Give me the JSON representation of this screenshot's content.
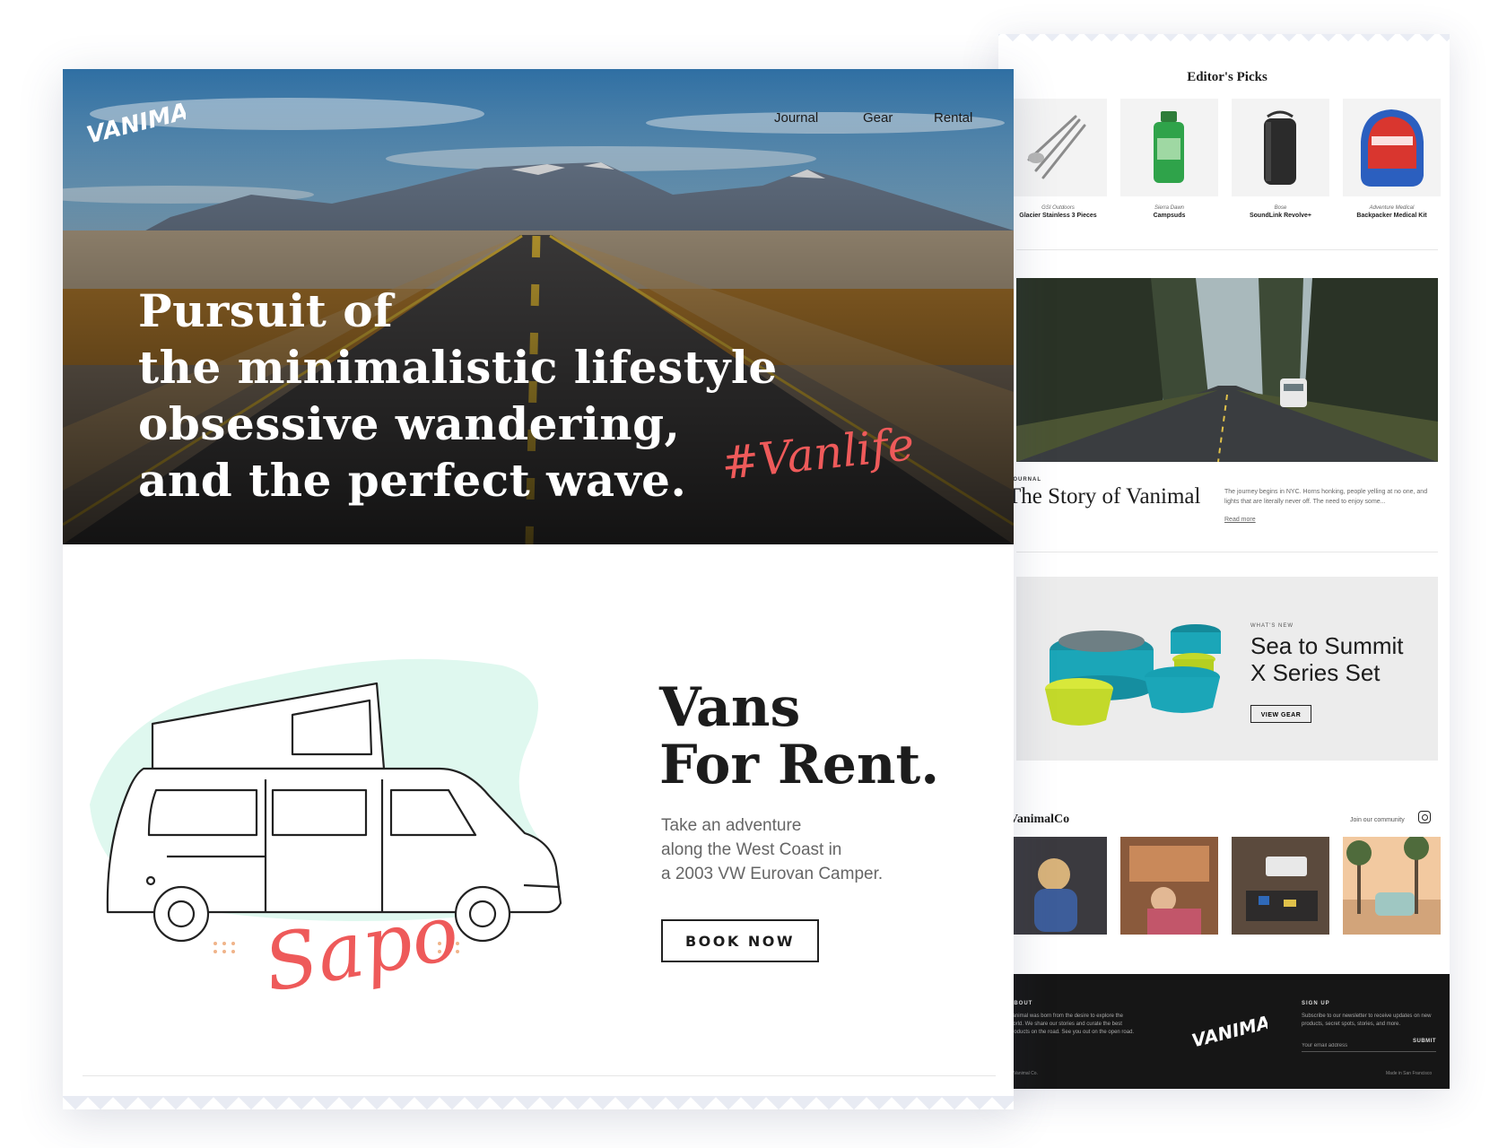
{
  "colors": {
    "accent": "#ee5a5a",
    "mint": "#dff8ef",
    "dark": "#1c1c1c",
    "footer_bg": "#161616"
  },
  "hero": {
    "logo_text": "VANIMAL",
    "nav": [
      "Journal",
      "Gear",
      "Rental"
    ],
    "headline": [
      "Pursuit of",
      "the minimalistic lifestyle",
      "obsessive wandering,",
      "and the perfect wave."
    ],
    "hashtag": "#Vanlife"
  },
  "rental": {
    "title": [
      "Vans",
      "For Rent."
    ],
    "description": [
      "Take an adventure",
      "along the West Coast in",
      "a 2003 VW Eurovan Camper."
    ],
    "button": "BOOK NOW",
    "van_name": "Sapo"
  },
  "editors_picks": {
    "title": "Editor's Picks",
    "items": [
      {
        "brand": "GSI Outdoors",
        "name": "Glacier Stainless 3 Pieces",
        "icon": "cutlery-icon"
      },
      {
        "brand": "Sierra Dawn",
        "name": "Campsuds",
        "icon": "soap-bottle-icon"
      },
      {
        "brand": "Bose",
        "name": "SoundLink Revolve+",
        "icon": "speaker-icon"
      },
      {
        "brand": "Adventure Medical",
        "name": "Backpacker Medical Kit",
        "icon": "medical-kit-icon"
      }
    ]
  },
  "journal": {
    "tag": "JOURNAL",
    "title": "The Story of Vanimal",
    "excerpt": "The journey begins in NYC. Horns honking, people yelling at no one, and lights that are literally never off. The need to enjoy some...",
    "read_more": "Read more"
  },
  "whats_new": {
    "tag": "WHAT'S NEW",
    "title": [
      "Sea to Summit",
      "X Series Set"
    ],
    "button": "VIEW GEAR"
  },
  "community": {
    "handle": "VanimalCo",
    "join": "Join our community"
  },
  "footer": {
    "about_heading": "ABOUT",
    "about_text": "Vanimal was born from the desire to explore the world. We share our stories and curate the best products on the road. See you out on the open road.",
    "signup_heading": "SIGN UP",
    "signup_text": "Subscribe to our newsletter to receive updates on new products, secret spots, stories, and more.",
    "email_placeholder": "Your email address",
    "submit": "SUBMIT",
    "copyright": "© Vanimal Co.",
    "made_in": "Made in San Francisco"
  }
}
